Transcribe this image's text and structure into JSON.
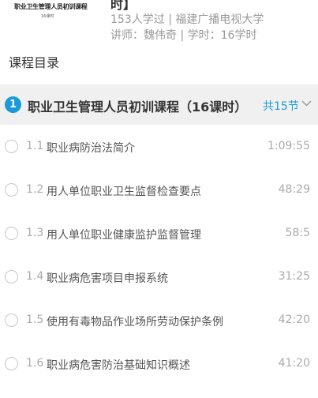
{
  "course": {
    "cover_title": "职业卫生管理人员初训课程",
    "cover_subtitle": "16课时",
    "title_tail": "时】",
    "learners": "153人学过",
    "separator": "|",
    "school": "福建广播电视大学",
    "teacher_label": "讲师：魏伟奇",
    "hours_label": "学时：16学时"
  },
  "catalog": {
    "heading": "课程目录",
    "chapter": {
      "number": "1",
      "title": "职业卫生管理人员初训课程（16课时）",
      "count": "共15节",
      "expand_icon": "chevron-down-icon"
    },
    "lessons": [
      {
        "num": "1.1",
        "title": "职业病防治法简介",
        "duration": "1:09:55"
      },
      {
        "num": "1.2",
        "title": "用人单位职业卫生监督检查要点",
        "duration": "48:29"
      },
      {
        "num": "1.3",
        "title": "用人单位职业健康监护监督管理",
        "duration": "58:5"
      },
      {
        "num": "1.4",
        "title": "职业病危害项目申报系统",
        "duration": "31:25"
      },
      {
        "num": "1.5",
        "title": "使用有毒物品作业场所劳动保护条例",
        "duration": "42:20"
      },
      {
        "num": "1.6",
        "title": "职业病危害防治基础知识概述",
        "duration": "41:20"
      }
    ]
  },
  "colors": {
    "accent": "#1a9bd7",
    "chapter_bg": "#f0f0f0",
    "muted": "#999999"
  }
}
